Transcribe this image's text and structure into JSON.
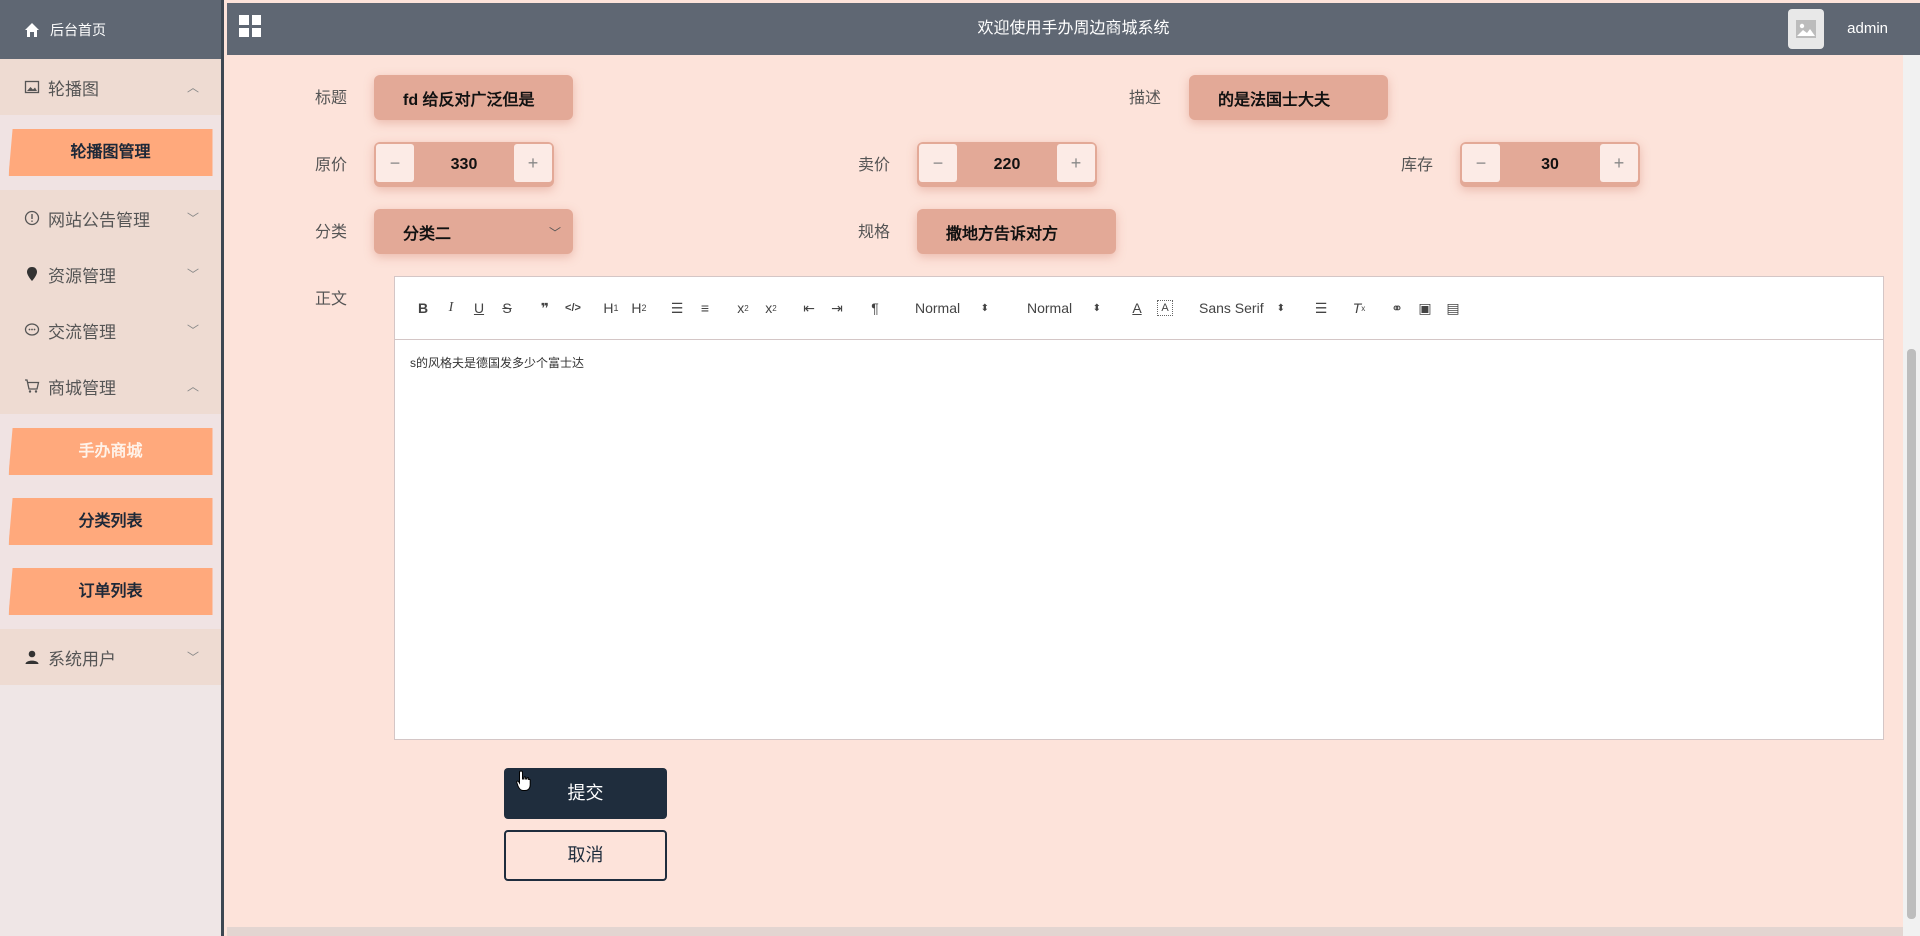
{
  "sidebar": {
    "home": "后台首页",
    "groups": [
      {
        "label": "轮播图",
        "expanded": true,
        "subitems": [
          "轮播图管理"
        ]
      },
      {
        "label": "网站公告管理",
        "expanded": false
      },
      {
        "label": "资源管理",
        "expanded": false
      },
      {
        "label": "交流管理",
        "expanded": false
      },
      {
        "label": "商城管理",
        "expanded": true,
        "subitems": [
          "手办商城",
          "分类列表",
          "订单列表"
        ]
      },
      {
        "label": "系统用户",
        "expanded": false
      }
    ]
  },
  "topbar": {
    "title": "欢迎使用手办周边商城系统",
    "user": "admin"
  },
  "form": {
    "title_label": "标题",
    "title_value": "fd 给反对广泛但是",
    "desc_label": "描述",
    "desc_value": "的是法国士大夫",
    "orig_price_label": "原价",
    "orig_price_value": "330",
    "sale_price_label": "卖价",
    "sale_price_value": "220",
    "stock_label": "库存",
    "stock_value": "30",
    "category_label": "分类",
    "category_value": "分类二",
    "spec_label": "规格",
    "spec_value": "撒地方告诉对方",
    "body_label": "正文",
    "editor": {
      "header_select": "Normal",
      "size_select": "Normal",
      "font_select": "Sans Serif",
      "content": "s的风格夫是德国发多少个富士达"
    },
    "submit_label": "提交",
    "cancel_label": "取消"
  },
  "colors": {
    "background": "#fde3da",
    "topbar": "#5f6773",
    "pill": "#e3a997",
    "sidebar_button": "#ffa97c",
    "submit": "#1f2d3d"
  }
}
